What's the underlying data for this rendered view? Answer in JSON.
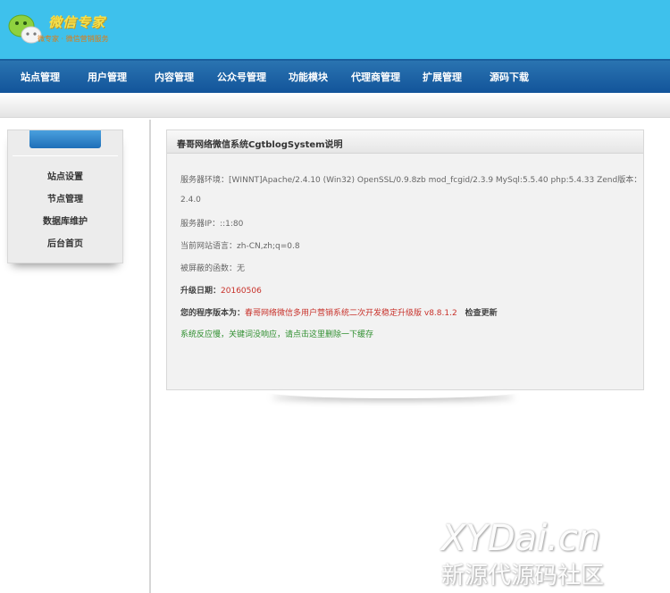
{
  "header": {
    "logo_title": "微信专家",
    "logo_subtitle": "微专家 · 微信营销服务"
  },
  "nav": {
    "items": [
      "站点管理",
      "用户管理",
      "内容管理",
      "公众号管理",
      "功能模块",
      "代理商管理",
      "扩展管理",
      "源码下载"
    ]
  },
  "sidebar": {
    "items": [
      "站点设置",
      "节点管理",
      "数据库维护",
      "后台首页"
    ]
  },
  "panel": {
    "title": "春哥网络微信系统CgtblogSystem说明",
    "server_env_label": "服务器环境：",
    "server_env_value": "[WINNT]Apache/2.4.10 (Win32) OpenSSL/0.9.8zb mod_fcgid/2.3.9 MySql:5.5.40 php:5.4.33   Zend版本：",
    "zend_version": "2.4.0",
    "server_ip_label": "服务器IP：",
    "server_ip_value": "::1:80",
    "language_label": "当前网站语言：",
    "language_value": "zh-CN,zh;q=0.8",
    "blocked_label": "被屏蔽的函数：",
    "blocked_value": "无",
    "upgrade_label": "升级日期：",
    "upgrade_value": "20160506",
    "version_label": "您的程序版本为：",
    "version_value": "春哥网络微信多用户营销系统二次开发稳定升级版 v8.8.1.2",
    "check_update": "检查更新",
    "cache_notice": "系统反应慢，关键词没响应，请点击这里删除一下缓存"
  },
  "watermark": {
    "main": "XYDai.cn",
    "sub": "新源代源码社区"
  }
}
